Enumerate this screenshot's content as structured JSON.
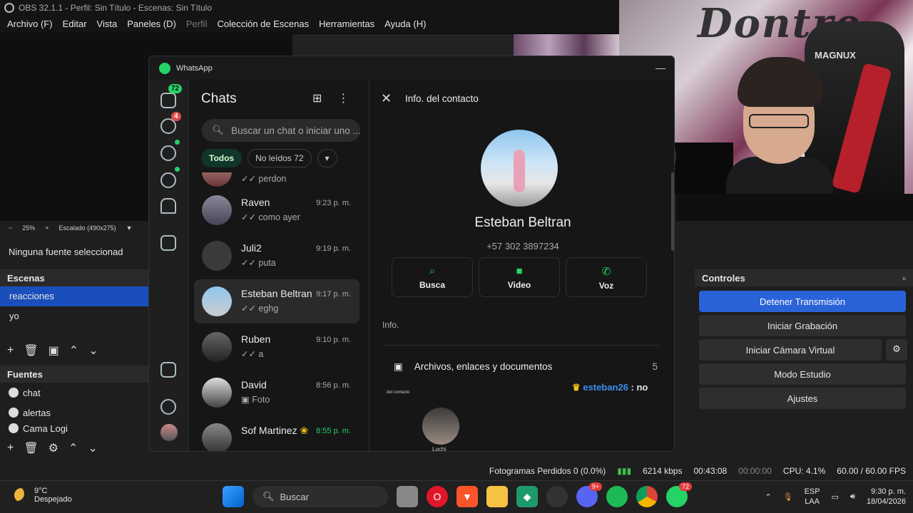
{
  "obs": {
    "title": "OBS 32.1.1 - Perfil: Sin Título - Escenas: Sin Título",
    "menu": [
      "Archivo (F)",
      "Editar",
      "Vista",
      "Paneles (D)",
      "Perfil",
      "Colección de Escenas",
      "Herramientas",
      "Ayuda (H)"
    ],
    "zoom": "25%",
    "scaling": "Escalado (490x275)",
    "no_source": "Ninguna fuente seleccionad",
    "scenes_title": "Escenas",
    "scenes": [
      "reacciones",
      "yo"
    ],
    "sources_title": "Fuentes",
    "sources": [
      "chat",
      "alertas",
      "Cama Logi"
    ],
    "controls_title": "Controles",
    "controls": {
      "stop_stream": "Detener Transmisión",
      "start_record": "Iniciar Grabación",
      "virtual_cam": "Iniciar Cámara Virtual",
      "studio_mode": "Modo Estudio",
      "settings": "Ajustes"
    },
    "status": {
      "dropped": "Fotogramas Perdidos 0 (0.0%)",
      "bitrate": "6214 kbps",
      "stream_time": "00:43:08",
      "rec_time": "00:00:00",
      "cpu": "CPU: 4.1%",
      "fps": "60.00 / 60.00 FPS"
    },
    "webcam_brand": "MAGNUX"
  },
  "whatsapp": {
    "window_title": "WhatsApp",
    "rail_badges": {
      "chats": "72",
      "calls": "4"
    },
    "list_title": "Chats",
    "search_placeholder": "Buscar un chat o iniciar uno ...",
    "filters": {
      "all": "Todos",
      "unread": "No leídos 72"
    },
    "chats": [
      {
        "name": "",
        "time": "",
        "preview": "perdon"
      },
      {
        "name": "Raven",
        "time": "9:23 p. m.",
        "preview": "como ayer"
      },
      {
        "name": "Juli2",
        "time": "9:19 p. m.",
        "preview": "puta"
      },
      {
        "name": "Esteban Beltran",
        "time": "9:17 p. m.",
        "preview": "eghg"
      },
      {
        "name": "Ruben",
        "time": "9:10 p. m.",
        "preview": "a"
      },
      {
        "name": "David",
        "time": "8:56 p. m.",
        "preview": "Foto"
      },
      {
        "name": "Sof Martinez",
        "time": "8:55 p. m.",
        "preview": ""
      }
    ],
    "detail": {
      "title": "Info. del contacto",
      "name": "Esteban Beltran",
      "phone": "+57 302 3897234",
      "actions": [
        "Busca",
        "Video",
        "Voz"
      ],
      "info_label": "Info.",
      "files_label": "Archivos, enlaces y documentos",
      "files_count": "5",
      "overlay_user": "esteban26",
      "overlay_msg": ": no",
      "tiny_label": "del contacto",
      "gallery_label": "Luchi"
    }
  },
  "taskbar": {
    "temp": "9°C",
    "weather": "Despejado",
    "search": "Buscar",
    "whatsapp_badge": "72",
    "discord_badge": "9+",
    "lang": "ESP",
    "lang2": "LAA",
    "time": "9:30 p. m.",
    "date": "18/04/2026"
  }
}
